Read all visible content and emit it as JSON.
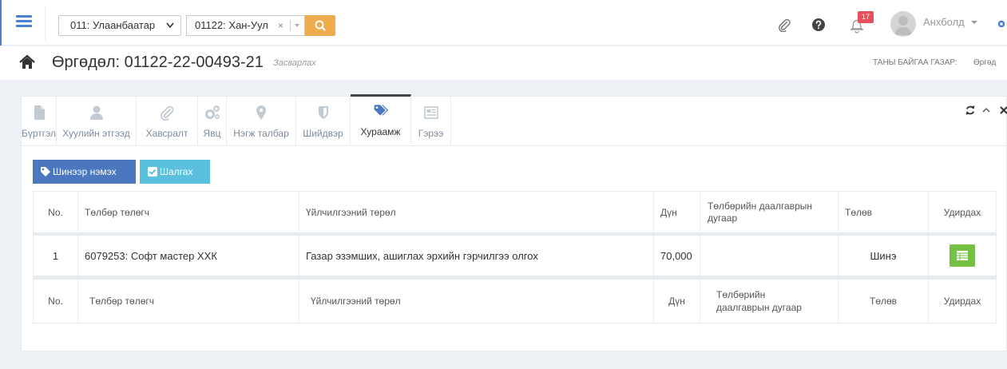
{
  "topbar": {
    "district_select": "011: Улаанбаатар",
    "subdistrict_select": "01122: Хан-Уул",
    "clear_glyph": "×",
    "notifications_count": "17",
    "user_name": "Анхболд"
  },
  "header": {
    "title": "Өргөдөл: 01122-22-00493-21",
    "subtitle": "Засварлах",
    "location_label": "ТАНЫ БАЙГАА ГАЗАР:",
    "location_value": "Өргөд"
  },
  "tabs": [
    {
      "label": "Бүртгэл",
      "icon": "document-icon"
    },
    {
      "label": "Хуулийн этгээд",
      "icon": "user-icon"
    },
    {
      "label": "Хавсралт",
      "icon": "paperclip-icon"
    },
    {
      "label": "Явц",
      "icon": "gears-icon"
    },
    {
      "label": "Нэгж талбар",
      "icon": "map-pin-icon"
    },
    {
      "label": "Шийдвэр",
      "icon": "shield-icon"
    },
    {
      "label": "Хураамж",
      "icon": "tags-icon",
      "active": true
    },
    {
      "label": "Гэрээ",
      "icon": "newspaper-icon"
    }
  ],
  "actions": {
    "add_new": "Шинээр нэмэх",
    "check": "Шалгах"
  },
  "table": {
    "columns": [
      "No.",
      "Төлбөр төлөгч",
      "Үйлчилгээний төрөл",
      "Дүн",
      "Төлбөрийн даалгаврын дугаар",
      "Төлөв",
      "Удирдах"
    ],
    "rows": [
      {
        "no": "1",
        "payer": "6079253: Софт мастер ХХК",
        "service": "Газар эзэмших, ашиглах эрхийн гэрчилгээ олгох",
        "amount": "70,000",
        "order_no": "",
        "status": "Шинэ"
      }
    ],
    "footer_columns": [
      "No.",
      "Төлбөр төлөгч",
      "Үйлчилгээний төрөл",
      "Дүн",
      "Төлбөрийн даалгаврын дугаар",
      "Төлөв",
      "Удирдах"
    ]
  },
  "colors": {
    "accent": "#4b77be",
    "info": "#5bc0de",
    "warning": "#f0ad4e",
    "success": "#76c043",
    "danger": "#e7505a"
  }
}
